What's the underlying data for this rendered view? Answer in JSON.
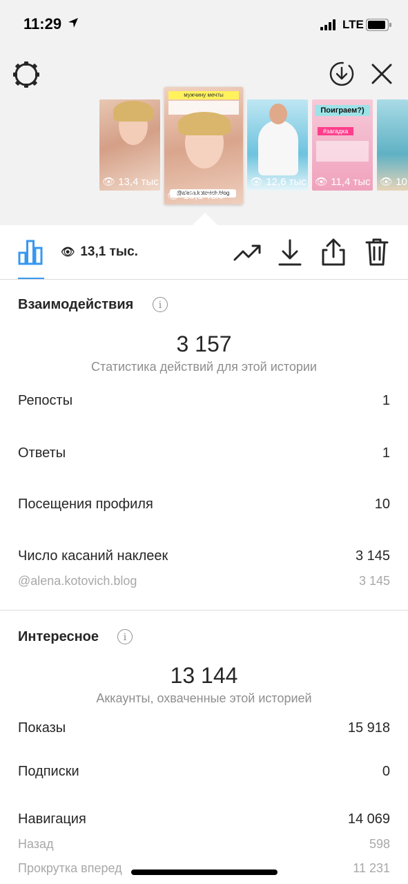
{
  "status_bar": {
    "time": "11:29",
    "network": "LTE"
  },
  "stories": [
    {
      "count": "13,4 тыс",
      "bg": "#d9b6a2"
    },
    {
      "count": "13,1 тыс",
      "bg": "#e7c3ae",
      "caption_top": "мужчину мечты",
      "handle": "@alena.kotovich.blog",
      "selected": true
    },
    {
      "count": "12,6 тыс",
      "bg": "#8fd0e6"
    },
    {
      "count": "11,4 тыс",
      "bg": "#f2a8c0",
      "title": "Поиграем?)",
      "tag": "#загадка"
    },
    {
      "count": "10,",
      "bg": "#89c9d6"
    }
  ],
  "toolbar": {
    "views": "13,1 тыс."
  },
  "interactions": {
    "title": "Взаимодействия",
    "total": "3 157",
    "subtitle": "Статистика действий для этой истории",
    "rows": [
      {
        "label": "Репосты",
        "value": "1"
      },
      {
        "label": "Ответы",
        "value": "1"
      },
      {
        "label": "Посещения профиля",
        "value": "10"
      },
      {
        "label": "Число касаний наклеек",
        "value": "3 145"
      }
    ],
    "sticker_row": {
      "label": "@alena.kotovich.blog",
      "value": "3 145"
    }
  },
  "discovery": {
    "title": "Интересное",
    "total": "13 144",
    "subtitle": "Аккаунты, охваченные этой историей",
    "rows": [
      {
        "label": "Показы",
        "value": "15 918"
      },
      {
        "label": "Подписки",
        "value": "0"
      },
      {
        "label": "Навигация",
        "value": "14 069"
      }
    ],
    "nav_rows": [
      {
        "label": "Назад",
        "value": "598"
      },
      {
        "label": "Прокрутка вперед",
        "value": "11 231"
      }
    ]
  }
}
